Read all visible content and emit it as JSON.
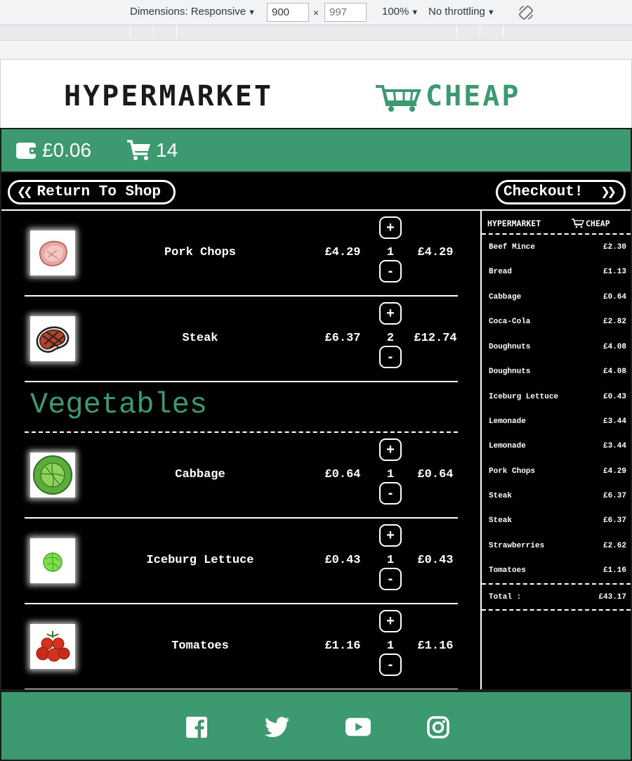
{
  "devtools": {
    "dimensions_label": "Dimensions: Responsive",
    "width_value": "900",
    "height_placeholder": "997",
    "times_sign": "×",
    "zoom": "100%",
    "throttling": "No throttling"
  },
  "brand": {
    "name_left": "HYPERMARKET",
    "name_right": "CHEAP",
    "green": "#3d9970"
  },
  "status": {
    "wallet_amount": "£0.06",
    "cart_count": "14"
  },
  "nav": {
    "return_label": "Return To Shop",
    "checkout_label": "Checkout!"
  },
  "cart_rows": [
    {
      "name": "Pork Chops",
      "price": "£4.29",
      "qty": "1",
      "subtotal": "£4.29",
      "icon": "pork-chop-icon"
    },
    {
      "name": "Steak",
      "price": "£6.37",
      "qty": "2",
      "subtotal": "£12.74",
      "icon": "steak-icon"
    }
  ],
  "section": {
    "title": "Vegetables"
  },
  "veg_rows": [
    {
      "name": "Cabbage",
      "price": "£0.64",
      "qty": "1",
      "subtotal": "£0.64",
      "icon": "cabbage-icon"
    },
    {
      "name": "Iceburg Lettuce",
      "price": "£0.43",
      "qty": "1",
      "subtotal": "£0.43",
      "icon": "lettuce-icon"
    },
    {
      "name": "Tomatoes",
      "price": "£1.16",
      "qty": "1",
      "subtotal": "£1.16",
      "icon": "tomatoes-icon"
    }
  ],
  "buttons": {
    "plus": "+",
    "minus": "-"
  },
  "receipt": {
    "items": [
      {
        "name": "Beef Mince",
        "price": "£2.30"
      },
      {
        "name": "Bread",
        "price": "£1.13"
      },
      {
        "name": "Cabbage",
        "price": "£0.64"
      },
      {
        "name": "Coca-Cola",
        "price": "£2.82"
      },
      {
        "name": "Doughnuts",
        "price": "£4.08"
      },
      {
        "name": "Doughnuts",
        "price": "£4.08"
      },
      {
        "name": "Iceburg Lettuce",
        "price": "£0.43"
      },
      {
        "name": "Lemonade",
        "price": "£3.44"
      },
      {
        "name": "Lemonade",
        "price": "£3.44"
      },
      {
        "name": "Pork Chops",
        "price": "£4.29"
      },
      {
        "name": "Steak",
        "price": "£6.37"
      },
      {
        "name": "Steak",
        "price": "£6.37"
      },
      {
        "name": "Strawberries",
        "price": "£2.62"
      },
      {
        "name": "Tomatoes",
        "price": "£1.16"
      }
    ],
    "total_label": "Total :",
    "total_value": "£43.17"
  },
  "footer": {
    "social": [
      "facebook-icon",
      "twitter-icon",
      "youtube-icon",
      "instagram-icon"
    ]
  }
}
